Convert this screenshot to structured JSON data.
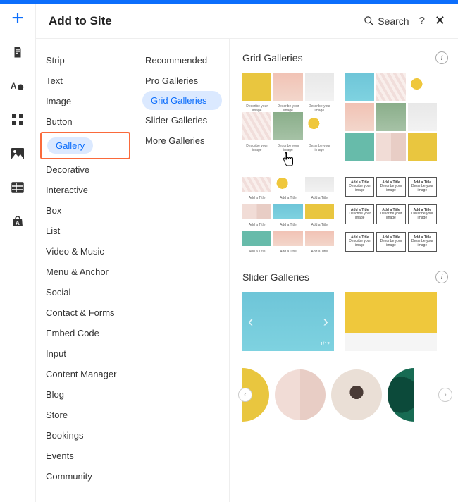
{
  "header": {
    "title": "Add to Site",
    "search_label": "Search"
  },
  "rail": {
    "icons": [
      "plus",
      "page",
      "theme",
      "apps",
      "media",
      "table",
      "store"
    ]
  },
  "categories": [
    "Strip",
    "Text",
    "Image",
    "Button",
    "Gallery",
    "Decorative",
    "Interactive",
    "Box",
    "List",
    "Video & Music",
    "Menu & Anchor",
    "Social",
    "Contact & Forms",
    "Embed Code",
    "Input",
    "Content Manager",
    "Blog",
    "Store",
    "Bookings",
    "Events",
    "Community"
  ],
  "categories_selected_index": 4,
  "subcategories": [
    "Recommended",
    "Pro Galleries",
    "Grid Galleries",
    "Slider Galleries",
    "More Galleries"
  ],
  "subcategories_selected_index": 2,
  "sections": {
    "grid": {
      "title": "Grid Galleries"
    },
    "slider": {
      "title": "Slider Galleries",
      "counter": "1/12"
    }
  },
  "tile_placeholder": {
    "title": "Add a Title",
    "sub": "Describe your image"
  }
}
